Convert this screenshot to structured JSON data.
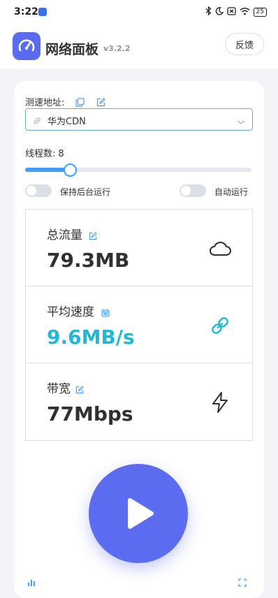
{
  "status_bar": {
    "time": "3:22",
    "battery": "25"
  },
  "header": {
    "title": "网络面板",
    "version": "v3.2.2",
    "feedback_label": "反馈"
  },
  "speed_test": {
    "address_label": "测速地址:",
    "selected_server": "华为CDN"
  },
  "threads": {
    "label": "线程数:",
    "value": "8",
    "min": 1,
    "max": 64
  },
  "switches": [
    {
      "label": "保持后台运行",
      "on": false
    },
    {
      "label": "自动运行",
      "on": false
    }
  ],
  "stats": [
    {
      "title": "总流量",
      "value": "79.3MB",
      "value_color": "#303133",
      "icon": "cloud-icon"
    },
    {
      "title": "平均速度",
      "value": "9.6MB/s",
      "value_color": "#1fb8d6",
      "icon": "link-icon"
    },
    {
      "title": "带宽",
      "value": "77Mbps",
      "value_color": "#303133",
      "icon": "lightning-icon"
    }
  ],
  "colors": {
    "accent": "#5b6cf0",
    "primary_blue": "#409eff",
    "speed_cyan": "#1fb8d6"
  }
}
